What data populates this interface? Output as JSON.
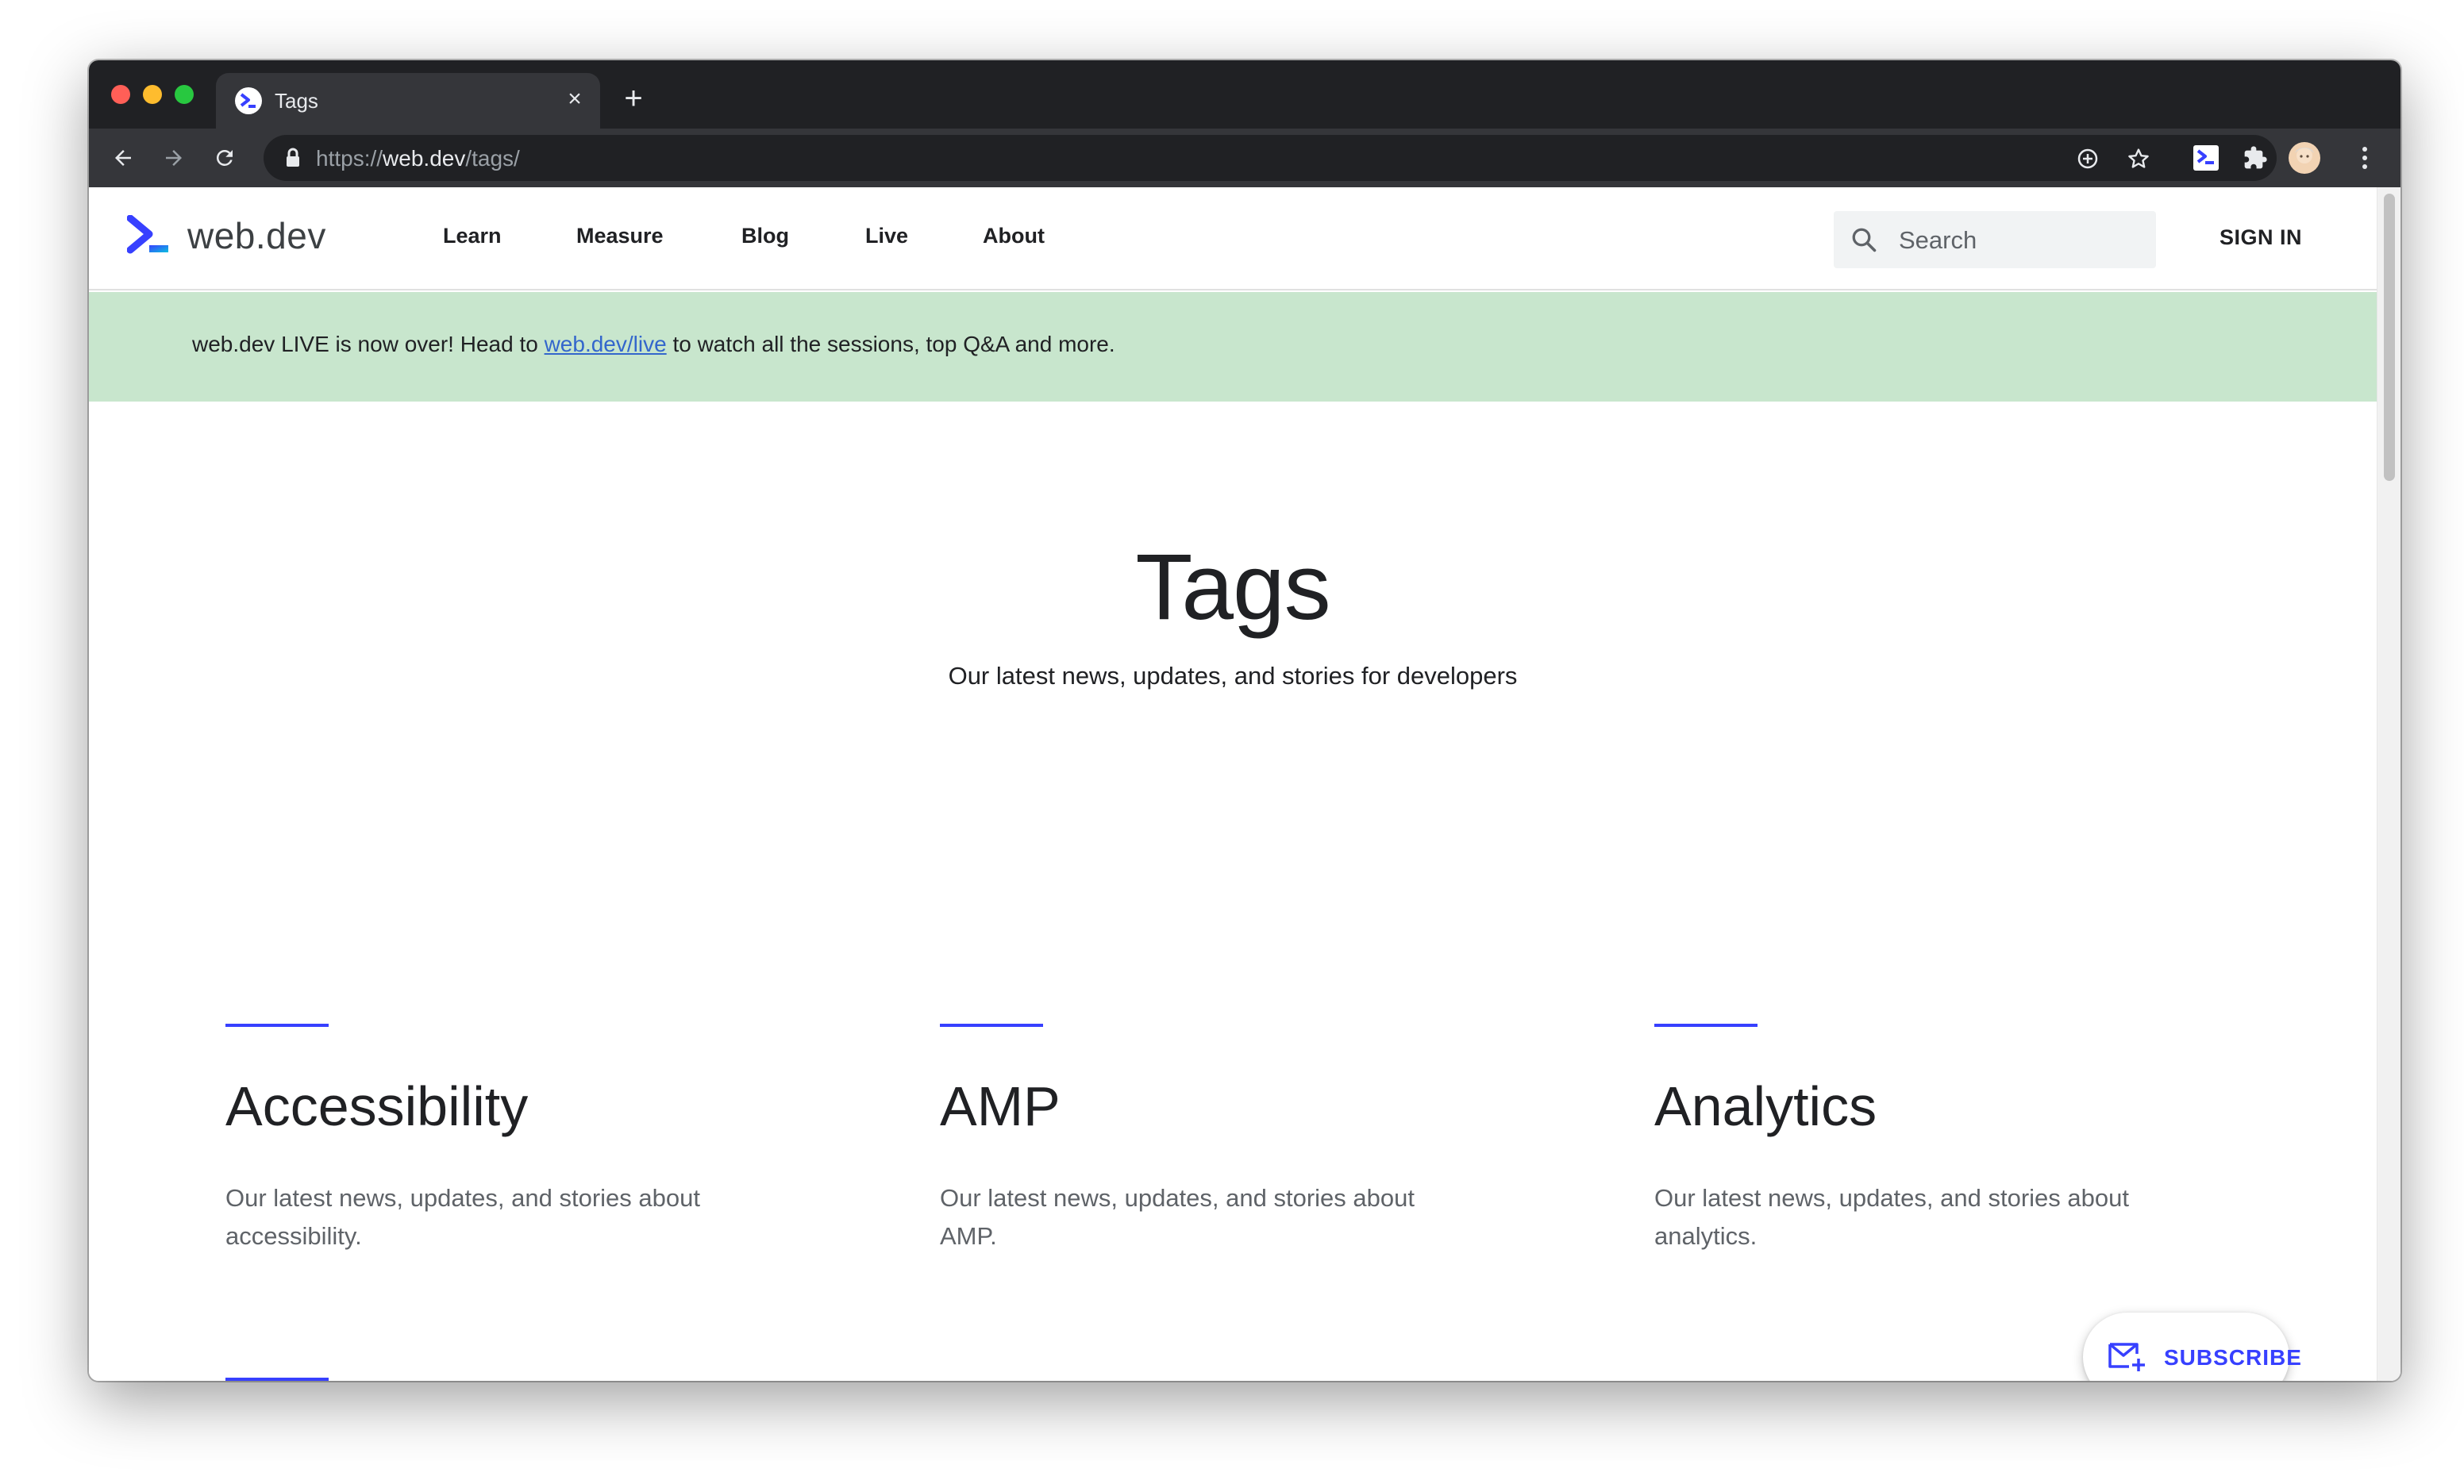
{
  "browser": {
    "tab_title": "Tags",
    "url_scheme": "https://",
    "url_host": "web.dev",
    "url_path": "/tags/"
  },
  "site": {
    "logo_text": "web.dev",
    "nav": [
      {
        "label": "Learn"
      },
      {
        "label": "Measure"
      },
      {
        "label": "Blog"
      },
      {
        "label": "Live"
      },
      {
        "label": "About"
      }
    ],
    "search_placeholder": "Search",
    "sign_in_label": "SIGN IN"
  },
  "banner": {
    "text_before": "web.dev LIVE is now over! Head to ",
    "link_text": "web.dev/live",
    "text_after": " to watch all the sessions, top Q&A and more."
  },
  "hero": {
    "title": "Tags",
    "subtitle": "Our latest news, updates, and stories for developers"
  },
  "tags": [
    {
      "title": "Accessibility",
      "description": "Our latest news, updates, and stories about accessibility."
    },
    {
      "title": "AMP",
      "description": "Our latest news, updates, and stories about AMP."
    },
    {
      "title": "Analytics",
      "description": "Our latest news, updates, and stories about analytics."
    }
  ],
  "subscribe_label": "SUBSCRIBE",
  "colors": {
    "accent": "#3740ff",
    "banner_bg": "#c8e6cd",
    "link": "#3366cc",
    "chrome_dark": "#202124"
  },
  "icons": [
    "back-icon",
    "forward-icon",
    "reload-icon",
    "lock-icon",
    "install-icon",
    "star-icon",
    "extension-webdev-icon",
    "puzzle-icon",
    "avatar",
    "menu-icon",
    "search-icon",
    "mail-icon"
  ]
}
